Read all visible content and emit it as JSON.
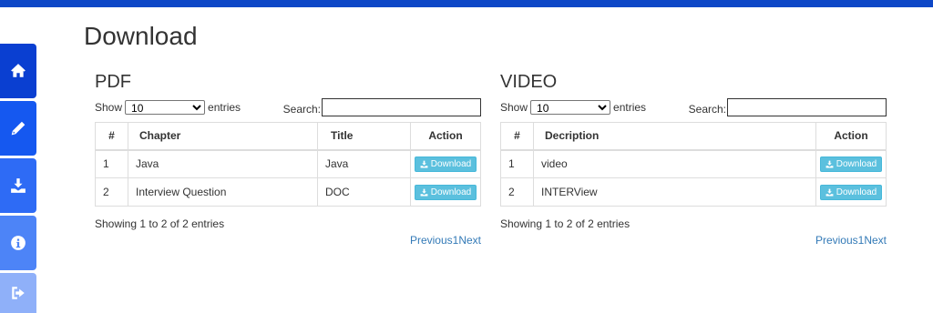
{
  "page": {
    "title": "Download"
  },
  "colors": {
    "topbar": "#0d47c7",
    "accent": "#5bc0de",
    "link": "#337ab7"
  },
  "sidebar": {
    "items": [
      {
        "icon": "home-icon",
        "color": "#0a3fd1"
      },
      {
        "icon": "pencil-icon",
        "color": "#1558f0"
      },
      {
        "icon": "download-icon",
        "color": "#2e6bf5"
      },
      {
        "icon": "info-icon",
        "color": "#4d84f7"
      },
      {
        "icon": "sign-out-icon",
        "color": "#8fb0f9"
      }
    ]
  },
  "pdf": {
    "heading": "PDF",
    "show_label": "Show",
    "length_value": "10",
    "entries_label": "entries",
    "search_label": "Search:",
    "search_value": "",
    "columns": [
      "#",
      "Chapter",
      "Title",
      "Action"
    ],
    "rows": [
      {
        "num": "1",
        "chapter": "Java",
        "title": "Java",
        "action": "Download"
      },
      {
        "num": "2",
        "chapter": "Interview Question",
        "title": "DOC",
        "action": "Download"
      }
    ],
    "info": "Showing 1 to 2 of 2 entries",
    "pager": {
      "prev": "Previous",
      "page": "1",
      "next": "Next"
    }
  },
  "video": {
    "heading": "VIDEO",
    "show_label": "Show",
    "length_value": "10",
    "entries_label": "entries",
    "search_label": "Search:",
    "search_value": "",
    "columns": [
      "#",
      "Decription",
      "Action"
    ],
    "rows": [
      {
        "num": "1",
        "description": "video",
        "action": "Download"
      },
      {
        "num": "2",
        "description": "INTERView",
        "action": "Download"
      }
    ],
    "info": "Showing 1 to 2 of 2 entries",
    "pager": {
      "prev": "Previous",
      "page": "1",
      "next": "Next"
    }
  }
}
